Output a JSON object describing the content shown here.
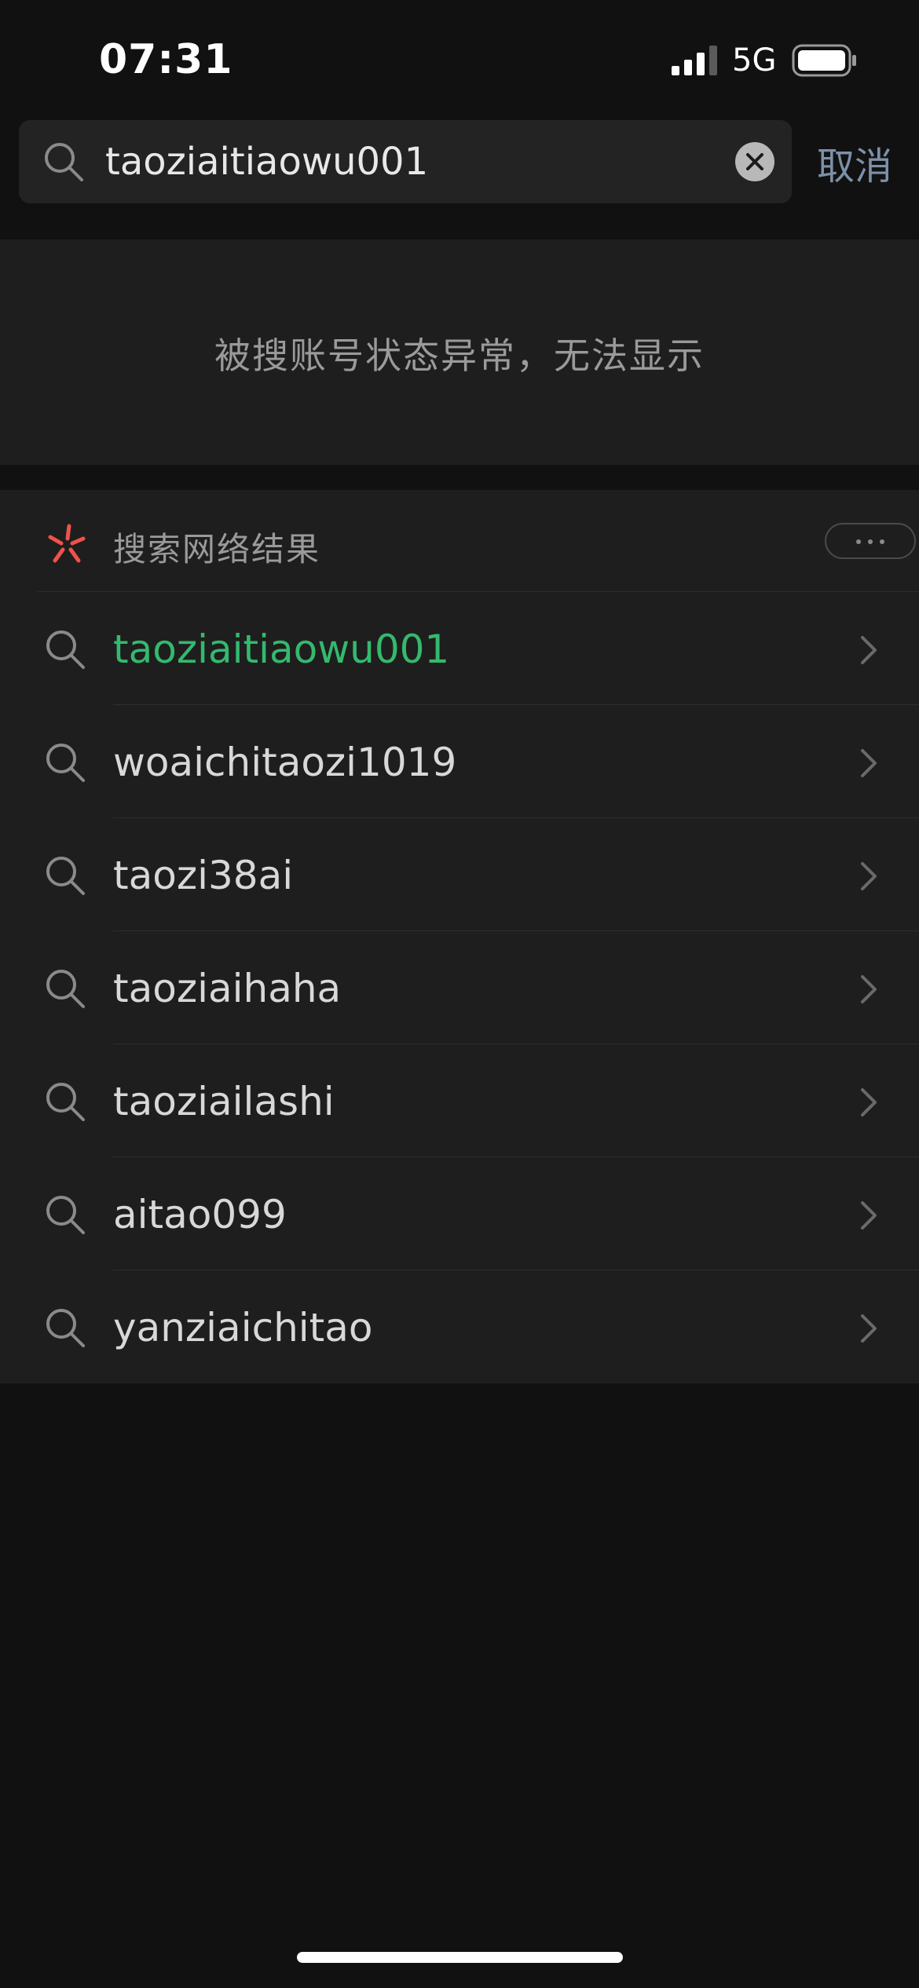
{
  "status_bar": {
    "time": "07:31",
    "network": "5G",
    "icons": [
      "signal-bars-icon",
      "battery-icon"
    ]
  },
  "search": {
    "query": "taoziaitiaowu001",
    "placeholder": "",
    "cancel_label": "取消",
    "icons": [
      "search-icon",
      "clear-icon"
    ]
  },
  "notice": {
    "text": "被搜账号状态异常，无法显示"
  },
  "web_results": {
    "title": "搜索网络结果",
    "accent_color": "#f0524a",
    "highlight_color": "#34b96e",
    "icons": [
      "sparkle-icon",
      "more-icon",
      "search-icon",
      "chevron-right-icon"
    ],
    "items": [
      {
        "label": "taoziaitiaowu001",
        "highlighted": true
      },
      {
        "label": "woaichitaozi1019",
        "highlighted": false
      },
      {
        "label": "taozi38ai",
        "highlighted": false
      },
      {
        "label": "taoziaihaha",
        "highlighted": false
      },
      {
        "label": "taoziailashi",
        "highlighted": false
      },
      {
        "label": "aitao099",
        "highlighted": false
      },
      {
        "label": "yanziaichitao",
        "highlighted": false
      }
    ]
  }
}
